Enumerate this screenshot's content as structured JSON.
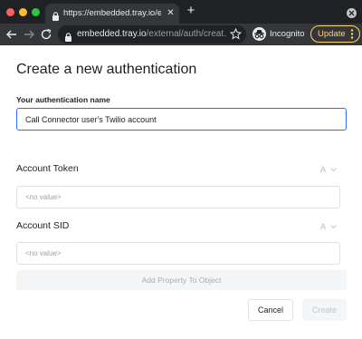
{
  "browser": {
    "tab_title": "https://embedded.tray.io/exter",
    "url_host": "embedded.tray.io",
    "url_path": "/external/auth/creat…",
    "incognito_label": "Incognito",
    "update_label": "Update",
    "icons": {
      "back": "arrow-left-icon",
      "forward": "arrow-right-icon",
      "reload": "reload-icon",
      "lock": "lock-icon",
      "bookmark": "star-icon",
      "incognito": "incognito-icon",
      "menu": "more-vertical-icon"
    },
    "colors": {
      "traffic_red": "#ff5f57",
      "traffic_yellow": "#febc2e",
      "traffic_green": "#28c840",
      "update_accent": "#fdd663"
    }
  },
  "form": {
    "title": "Create a new authentication",
    "name_label": "Your authentication name",
    "name_value": "Call Connector user's Twilio account",
    "fields": [
      {
        "label": "Account Token",
        "type_letter": "A",
        "placeholder": "<no value>",
        "value": ""
      },
      {
        "label": "Account SID",
        "type_letter": "A",
        "placeholder": "<no value>",
        "value": ""
      }
    ],
    "add_property_label": "Add Property To Object",
    "cancel_label": "Cancel",
    "create_label": "Create",
    "colors": {
      "focus_border": "#2f6bff",
      "text": "#1e1e24"
    }
  }
}
